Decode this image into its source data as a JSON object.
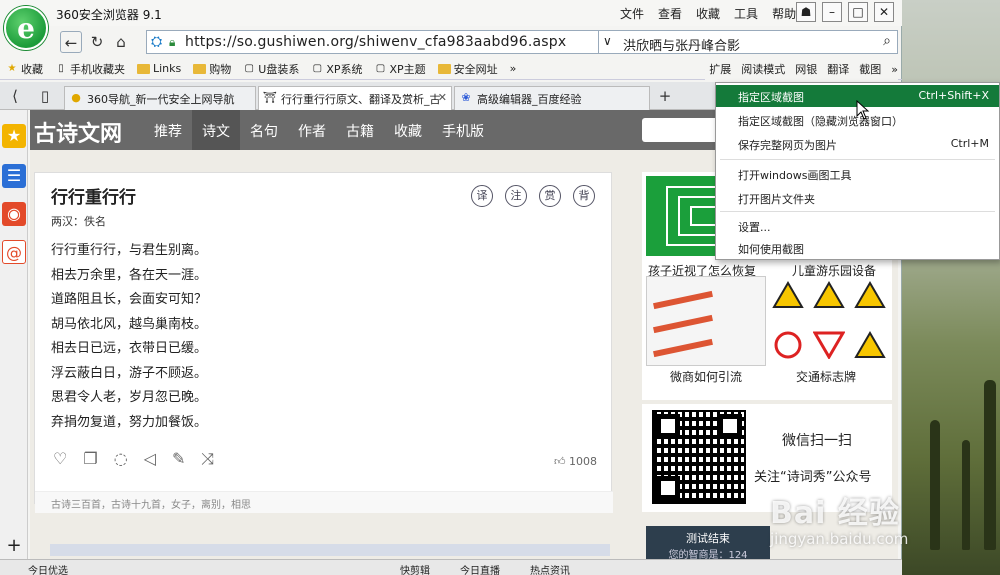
{
  "window": {
    "title": "360安全浏览器 9.1",
    "menus": [
      "文件",
      "查看",
      "收藏",
      "工具",
      "帮助"
    ]
  },
  "address": {
    "url": "https://so.gushiwen.org/shiwenv_cfa983aabd96.aspx",
    "search_query": "洪欣晒与张丹峰合影"
  },
  "bookmarks": [
    {
      "label": "收藏",
      "icon": "star-icon"
    },
    {
      "label": "手机收藏夹",
      "icon": "phone-icon"
    },
    {
      "label": "Links",
      "icon": "folder-icon"
    },
    {
      "label": "购物",
      "icon": "folder-icon"
    },
    {
      "label": "U盘装系",
      "icon": "page-icon"
    },
    {
      "label": "XP系统",
      "icon": "page-icon"
    },
    {
      "label": "XP主题",
      "icon": "page-icon"
    },
    {
      "label": "安全网址",
      "icon": "folder-icon"
    }
  ],
  "bookmarks_overflow": "»",
  "toolbar_right": [
    "扩展",
    "阅读模式",
    "网银",
    "翻译",
    "截图"
  ],
  "tabs": [
    {
      "label": "360导航_新一代安全上网导航"
    },
    {
      "label": "行行重行行原文、翻译及赏析_古"
    },
    {
      "label": "高级编辑器_百度经验"
    }
  ],
  "site": {
    "brand": "古诗文网",
    "nav": [
      "推荐",
      "诗文",
      "名句",
      "作者",
      "古籍",
      "收藏",
      "手机版"
    ],
    "active_nav": "诗文"
  },
  "poem": {
    "title": "行行重行行",
    "author": "两汉：佚名",
    "lines": [
      "行行重行行，与君生别离。",
      "相去万余里，各在天一涯。",
      "道路阻且长，会面安可知？",
      "胡马依北风，越鸟巢南枝。",
      "相去日已远，衣带日已缓。",
      "浮云蔽白日，游子不顾返。",
      "思君令人老，岁月忽已晚。",
      "弃捐勿复道，努力加餐饭。"
    ],
    "circles": [
      "译",
      "注",
      "赏",
      "背"
    ],
    "likes": "1008",
    "tags": "古诗三百首，古诗十九首，女子，离别，相思"
  },
  "ads": {
    "label1": "孩子近视了怎么恢复",
    "label2": "儿童游乐园设备",
    "label3": "微商如何引流",
    "label4": "交通标志牌",
    "qr_title": "微信扫一扫",
    "qr_follow": "关注“诗词秀”公众号",
    "test_title": "测试结束",
    "test_sub": "您的智商是：124"
  },
  "context_menu": [
    {
      "label": "指定区域截图",
      "shortcut": "Ctrl+Shift+X",
      "highlighted": true
    },
    {
      "label": "指定区域截图（隐藏浏览器窗口）",
      "shortcut": ""
    },
    {
      "label": "保存完整网页为图片",
      "shortcut": "Ctrl+M"
    },
    {
      "label": "打开windows画图工具",
      "shortcut": ""
    },
    {
      "label": "打开图片文件夹",
      "shortcut": ""
    },
    {
      "label": "设置...",
      "shortcut": ""
    },
    {
      "label": "如何使用截图",
      "shortcut": ""
    }
  ],
  "status": {
    "left": "今日优选",
    "mid1": "快剪辑",
    "mid2": "今日直播",
    "mid3": "热点资讯"
  },
  "watermark": {
    "line1": "Bai 经验",
    "line2": "jingyan.baidu.com"
  },
  "colors": {
    "accent": "#147a3a",
    "site_nav": "#696969"
  }
}
